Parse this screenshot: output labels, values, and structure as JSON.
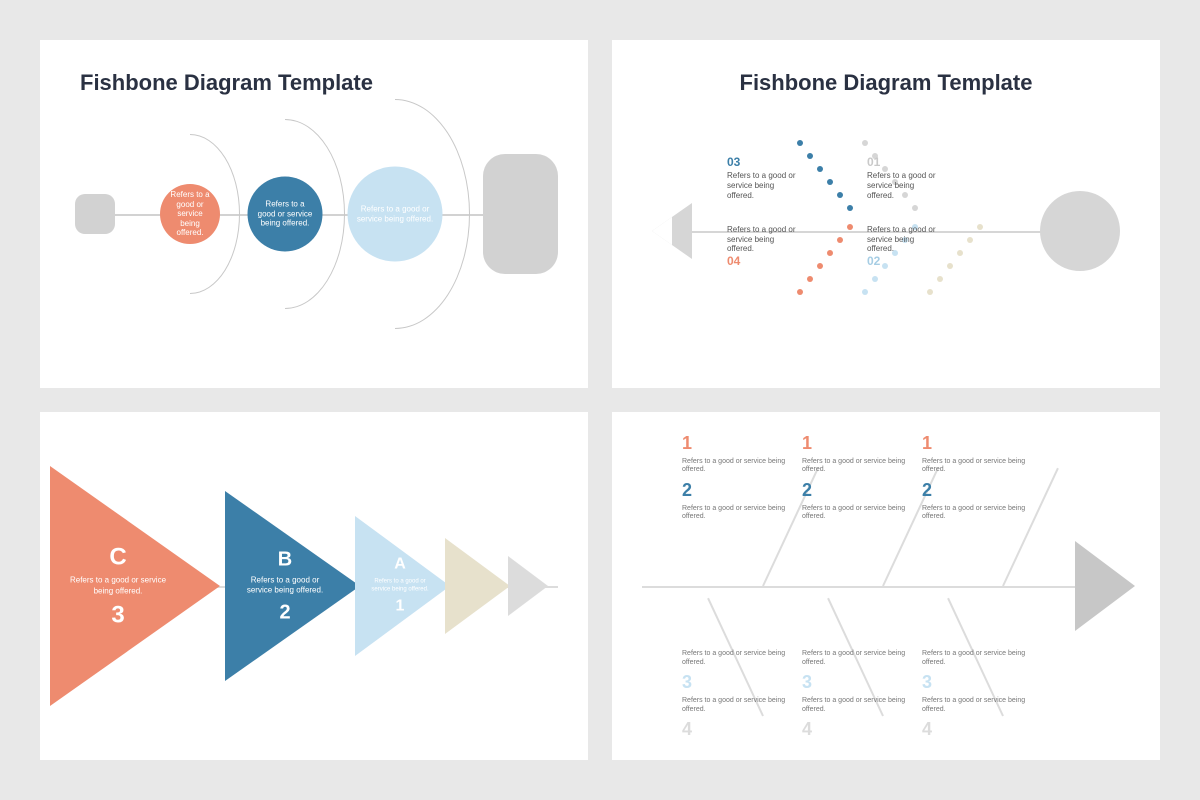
{
  "slide1": {
    "title": "Fishbone Diagram Template",
    "bubbles": [
      "Refers to a good or service being offered.",
      "Refers to a good or service being offered.",
      "Refers to a good or service being offered."
    ]
  },
  "slide2": {
    "title": "Fishbone Diagram Template",
    "items": [
      {
        "num": "01",
        "text": "Refers to a good or service being offered."
      },
      {
        "num": "02",
        "text": "Refers to a good or service being offered."
      },
      {
        "num": "03",
        "text": "Refers to a good or service being offered."
      },
      {
        "num": "04",
        "text": "Refers to a good or service being offered."
      }
    ]
  },
  "slide3": {
    "triangles": [
      {
        "letter": "C",
        "num": "3",
        "text": "Refers to a good or service being offered."
      },
      {
        "letter": "B",
        "num": "2",
        "text": "Refers to a good or service being offered."
      },
      {
        "letter": "A",
        "num": "1",
        "text": "Refers to a good or service being offered."
      }
    ]
  },
  "slide4": {
    "item_text": "Refers to a good or service being offered.",
    "nums": [
      "1",
      "2",
      "3",
      "4"
    ]
  }
}
